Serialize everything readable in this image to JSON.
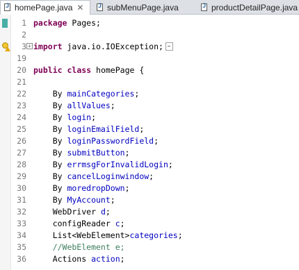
{
  "tabs": [
    {
      "label": "homePage.java",
      "active": true,
      "close": "✕"
    },
    {
      "label": "subMenuPage.java",
      "active": false
    },
    {
      "label": "productDetailPage.java",
      "active": false
    }
  ],
  "colors": {
    "keyword": "#7f0055",
    "field": "#0000c0",
    "comment": "#3f7f5f"
  },
  "code": {
    "fold_expand_symbol": "⊕",
    "lines": [
      {
        "num": "1",
        "parts": [
          [
            "kw",
            "package"
          ],
          [
            "t",
            " Pages;"
          ]
        ]
      },
      {
        "num": "2",
        "parts": []
      },
      {
        "num": "3",
        "parts": [
          [
            "kw",
            "import"
          ],
          [
            "t",
            " java.io.IOException;"
          ]
        ],
        "folded": true
      },
      {
        "num": "19",
        "parts": []
      },
      {
        "num": "20",
        "parts": [
          [
            "kw",
            "public"
          ],
          [
            "t",
            " "
          ],
          [
            "kw",
            "class"
          ],
          [
            "t",
            " homePage {"
          ]
        ]
      },
      {
        "num": "21",
        "parts": []
      },
      {
        "num": "22",
        "parts": [
          [
            "t",
            "    By "
          ],
          [
            "fld",
            "mainCategories"
          ],
          [
            "t",
            ";"
          ]
        ]
      },
      {
        "num": "23",
        "parts": [
          [
            "t",
            "    By "
          ],
          [
            "fld",
            "allValues"
          ],
          [
            "t",
            ";"
          ]
        ]
      },
      {
        "num": "24",
        "parts": [
          [
            "t",
            "    By "
          ],
          [
            "fld",
            "login"
          ],
          [
            "t",
            ";"
          ]
        ]
      },
      {
        "num": "25",
        "parts": [
          [
            "t",
            "    By "
          ],
          [
            "fld",
            "loginEmailField"
          ],
          [
            "t",
            ";"
          ]
        ]
      },
      {
        "num": "26",
        "parts": [
          [
            "t",
            "    By "
          ],
          [
            "fld",
            "loginPasswordField"
          ],
          [
            "t",
            ";"
          ]
        ]
      },
      {
        "num": "27",
        "parts": [
          [
            "t",
            "    By "
          ],
          [
            "fld",
            "submitButton"
          ],
          [
            "t",
            ";"
          ]
        ]
      },
      {
        "num": "28",
        "parts": [
          [
            "t",
            "    By "
          ],
          [
            "fld",
            "errmsgForInvalidLogin"
          ],
          [
            "t",
            ";"
          ]
        ]
      },
      {
        "num": "29",
        "parts": [
          [
            "t",
            "    By "
          ],
          [
            "fld",
            "cancelLoginwindow"
          ],
          [
            "t",
            ";"
          ]
        ]
      },
      {
        "num": "30",
        "parts": [
          [
            "t",
            "    By "
          ],
          [
            "fld",
            "moredropDown"
          ],
          [
            "t",
            ";"
          ]
        ]
      },
      {
        "num": "31",
        "parts": [
          [
            "t",
            "    By "
          ],
          [
            "fld",
            "MyAccount"
          ],
          [
            "t",
            ";"
          ]
        ]
      },
      {
        "num": "32",
        "parts": [
          [
            "t",
            "    WebDriver "
          ],
          [
            "fld",
            "d"
          ],
          [
            "t",
            ";"
          ]
        ]
      },
      {
        "num": "33",
        "parts": [
          [
            "t",
            "    configReader "
          ],
          [
            "fld",
            "c"
          ],
          [
            "t",
            ";"
          ]
        ]
      },
      {
        "num": "34",
        "parts": [
          [
            "t",
            "    List<WebElement>"
          ],
          [
            "fld",
            "categories"
          ],
          [
            "t",
            ";"
          ]
        ]
      },
      {
        "num": "35",
        "parts": [
          [
            "cmt",
            "    //WebElement e;"
          ]
        ]
      },
      {
        "num": "36",
        "parts": [
          [
            "t",
            "    Actions "
          ],
          [
            "fld",
            "action"
          ],
          [
            "t",
            ";"
          ]
        ]
      }
    ]
  }
}
